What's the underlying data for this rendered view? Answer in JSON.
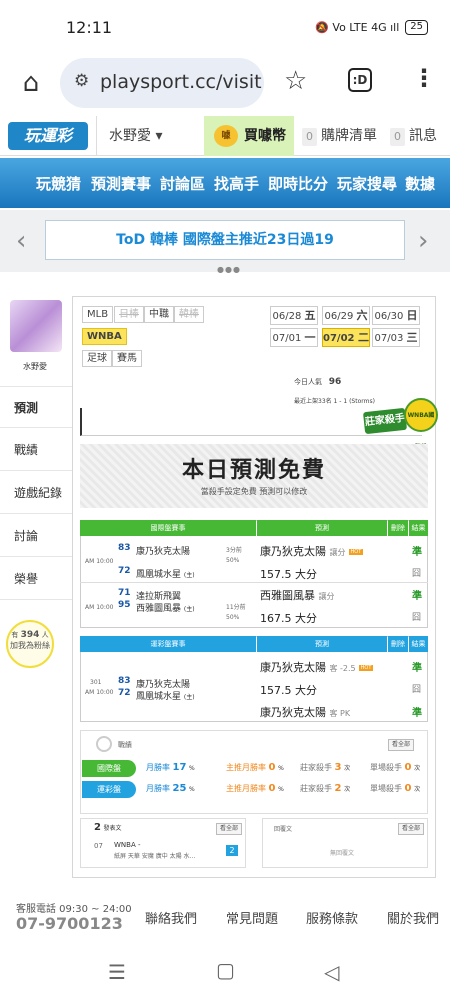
{
  "status": {
    "time": "12:11",
    "icons": "🔕 Vo LTE 4G ıll",
    "battery": "25"
  },
  "browser": {
    "url": "playsport.cc/visit",
    "tabs_label": ":D"
  },
  "site": {
    "logo": "玩運彩",
    "user": "水野愛",
    "coin": "買噱幣",
    "coin_icon": "噱",
    "cart_count": "0",
    "cart_label": "購牌清單",
    "msg_count": "0",
    "msg_label": "訊息"
  },
  "nav": [
    "玩競猜",
    "預測賽事",
    "討論區",
    "找高手",
    "即時比分",
    "玩家搜尋",
    "數據"
  ],
  "banner": "ToD 韓棒 國際盤主推近23日過19",
  "sidebar": {
    "avatar_name": "水野愛",
    "items": [
      "預測",
      "戰績",
      "遊戲紀錄",
      "討論",
      "榮譽"
    ],
    "active": "預測",
    "fans_prefix": "有",
    "fans_count": "394",
    "fans_suffix": "人",
    "fans_line2": "加我為粉絲"
  },
  "sports": {
    "row1": [
      "MLB",
      "日棒",
      "中職",
      "韓棒"
    ],
    "row1_disabled": [
      "日棒",
      "韓棒"
    ],
    "row2": [
      "WNBA"
    ],
    "row3": [
      "足球",
      "賽馬"
    ]
  },
  "dates": [
    {
      "d": "06/28",
      "w": "五",
      "sel": false
    },
    {
      "d": "06/29",
      "w": "六",
      "sel": false
    },
    {
      "d": "06/30",
      "w": "日",
      "sel": false
    },
    {
      "d": "07/01",
      "w": "一",
      "sel": false
    },
    {
      "d": "07/02",
      "w": "二",
      "sel": true
    },
    {
      "d": "07/03",
      "w": "三",
      "sel": false
    }
  ],
  "stats": {
    "popularity_label": "今日人氣",
    "popularity": "96",
    "last_label": "最近上架33名 1 - 1 (Storms)"
  },
  "badge": {
    "main": "莊家殺手",
    "sub": "WNBA國際盤"
  },
  "free": {
    "title": "本日預測免費",
    "sub": "當殺手設定免費 預測可以修改"
  },
  "table1": {
    "headers": [
      "國際盤賽事",
      "預測",
      "刪除",
      "結果"
    ],
    "games": [
      {
        "time": "AM 10:00",
        "home_num": "83",
        "home": "康乃狄克太陽",
        "away_num": "72",
        "away": "鳳凰城水星",
        "away_tag": "(主)",
        "spread": "3分前",
        "pct": "50%",
        "picks": [
          {
            "text": "康乃狄克太陽",
            "tag": "讓分",
            "hot": "HOT",
            "result": "準"
          },
          {
            "text": "157.5 大分",
            "tag": "",
            "hot": "",
            "result": "囧"
          }
        ]
      },
      {
        "time": "AM 10:00",
        "home_num": "71",
        "home": "達拉斯飛翼",
        "away_num": "95",
        "away": "西雅圖風暴",
        "away_tag": "(主)",
        "spread": "11分前",
        "pct": "50%",
        "picks": [
          {
            "text": "西雅圖風暴",
            "tag": "讓分",
            "hot": "",
            "result": "準"
          },
          {
            "text": "167.5 大分",
            "tag": "",
            "hot": "",
            "result": "囧"
          }
        ]
      }
    ]
  },
  "table2": {
    "headers": [
      "運彩盤賽事",
      "預測",
      "刪除",
      "結果"
    ],
    "game": {
      "id": "301",
      "time": "AM 10:00",
      "home_num": "83",
      "home": "康乃狄克太陽",
      "away_num": "72",
      "away": "鳳凰城水星",
      "away_tag": "(主)"
    },
    "picks": [
      {
        "text": "康乃狄克太陽",
        "tag": "客 -2.5",
        "hot": "HOT",
        "result": "準"
      },
      {
        "text": "157.5 大分",
        "tag": "",
        "hot": "",
        "result": "囧"
      },
      {
        "text": "康乃狄克太陽",
        "tag": "客 PK",
        "hot": "",
        "result": "準"
      }
    ]
  },
  "record": {
    "title": "戰績",
    "view_all": "看全部",
    "rows": [
      {
        "label": "國際盤",
        "win_label": "月勝率",
        "win": "17",
        "main_label": "主推月勝率",
        "main": "0",
        "k_label": "莊家殺手",
        "k": "3",
        "s_label": "單場殺手",
        "s": "0",
        "color": "#47b836"
      },
      {
        "label": "運彩盤",
        "win_label": "月勝率",
        "win": "25",
        "main_label": "主推月勝率",
        "main": "0",
        "k_label": "莊家殺手",
        "k": "2",
        "s_label": "單場殺手",
        "s": "0",
        "color": "#22a3e0"
      }
    ]
  },
  "articles": {
    "count": "2",
    "label": "發表文",
    "view_all": "看全部",
    "item_num": "07",
    "item_title": "WNBA -",
    "item_sub": "紙屏 天華 安魔 廣中 太陽 水...",
    "item_tag": "2",
    "reply_label": "回覆文",
    "reply_view_all": "看全部",
    "reply_empty": "無回覆文"
  },
  "footer": {
    "hours": "客服電話 09:30 ~ 24:00",
    "phone": "07-9700123",
    "links": [
      "聯絡我們",
      "常見問題",
      "服務條款",
      "關於我們"
    ]
  }
}
